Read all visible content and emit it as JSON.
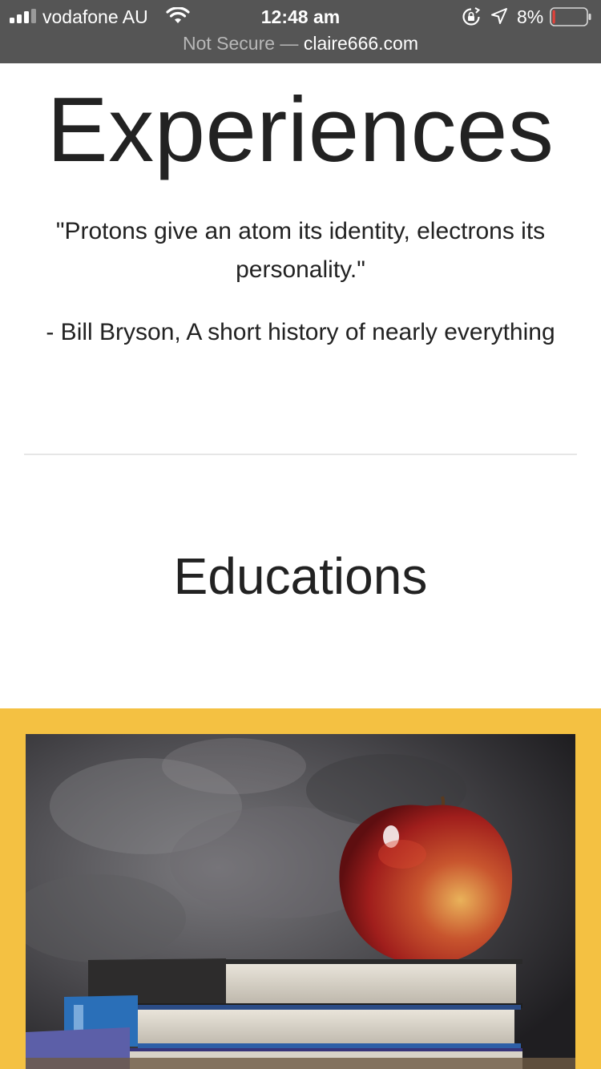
{
  "status_bar": {
    "carrier": "vodafone AU",
    "time": "12:48 am",
    "battery_percent": "8%",
    "battery_level": 0.08,
    "battery_color": "#e0423b"
  },
  "url_bar": {
    "security": "Not Secure —",
    "domain": "claire666.com"
  },
  "main": {
    "title": "Experiences",
    "quote": "\"Protons give an atom its identity, electrons its personality.\"",
    "attribution": "- Bill Bryson, A short history of nearly everything",
    "section_title": "Educations"
  },
  "education_card": {
    "accent_color": "#f4c142",
    "image_icon": "apple-on-books-image"
  }
}
